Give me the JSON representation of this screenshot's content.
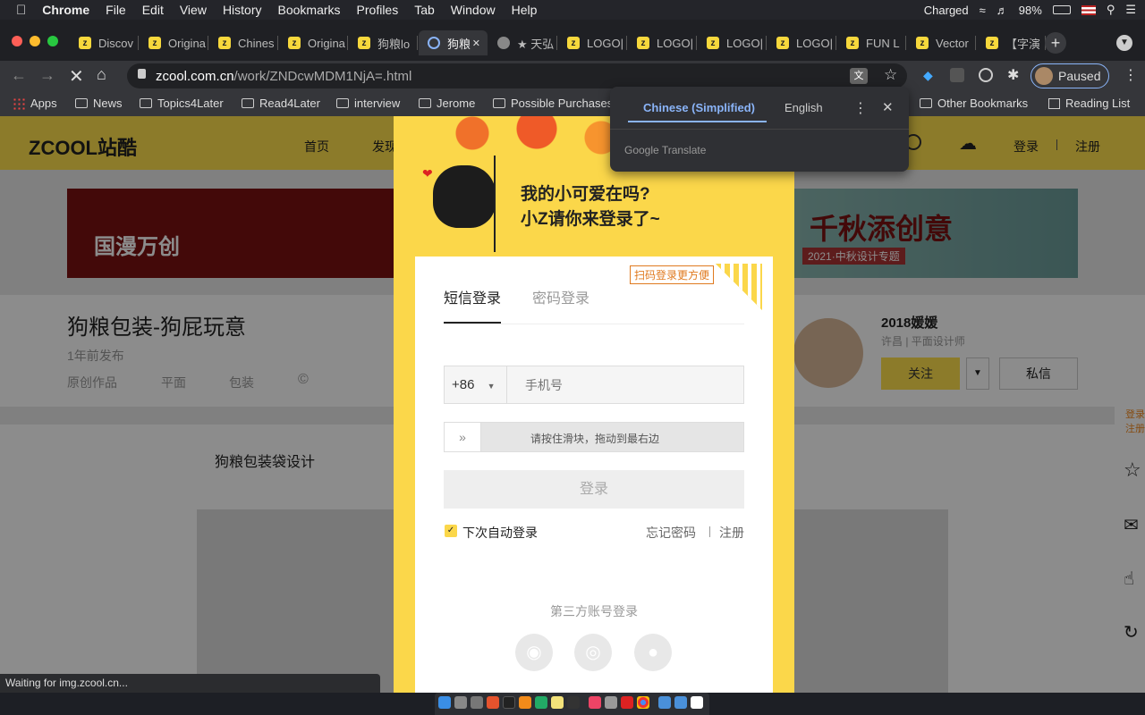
{
  "menubar": {
    "app": "Chrome",
    "items": [
      "File",
      "Edit",
      "View",
      "History",
      "Bookmarks",
      "Profiles",
      "Tab",
      "Window",
      "Help"
    ],
    "battery_status": "Charged",
    "battery_percent": "98%"
  },
  "tabs": [
    {
      "label": "Discov"
    },
    {
      "label": "Origina"
    },
    {
      "label": "Chines"
    },
    {
      "label": "Origina"
    },
    {
      "label": "狗粮lo"
    },
    {
      "label": "狗粮"
    },
    {
      "label": "★ 天弘"
    },
    {
      "label": "LOGO|"
    },
    {
      "label": "LOGO|"
    },
    {
      "label": "LOGO|"
    },
    {
      "label": "LOGO|"
    },
    {
      "label": "FUN L"
    },
    {
      "label": "Vector"
    },
    {
      "label": "【字演"
    }
  ],
  "address": {
    "host": "zcool.com.cn",
    "path": "/work/ZNDcwMDM1NjA=.html"
  },
  "profile": {
    "label": "Paused"
  },
  "bookmarks": {
    "apps": "Apps",
    "items": [
      "News",
      "Topics4Later",
      "Read4Later",
      "interview",
      "Jerome",
      "Possible Purchases"
    ],
    "other": "Other Bookmarks",
    "reading": "Reading List"
  },
  "translate": {
    "lang_source": "Chinese (Simplified)",
    "lang_target": "English",
    "provider": "Google Translate"
  },
  "site": {
    "logo": "ZCOOL站酷",
    "nav": [
      "首页",
      "发现"
    ],
    "login": "登录",
    "register": "注册",
    "banner_left": "国漫万创",
    "banner_right": "千秋添创意",
    "banner_sub": "2021·中秋设计专题",
    "work_title": "狗粮包装-狗屁玩意",
    "published": "1年前发布",
    "tags": [
      "原创作品",
      "平面",
      "包装"
    ],
    "section_title": "狗粮包装袋设计",
    "author": "2018媛媛",
    "author_meta": "许昌 | 平面设计师",
    "follow": "关注",
    "message": "私信",
    "side_login": "登录",
    "side_register": "注册"
  },
  "modal": {
    "greeting1": "我的小可爱在吗?",
    "greeting2": "小Z请你来登录了~",
    "qr_hint": "扫码登录更方便",
    "tab_sms": "短信登录",
    "tab_password": "密码登录",
    "country_code": "+86",
    "phone_placeholder": "手机号",
    "slider_text": "请按住滑块，拖动到最右边",
    "login_button": "登录",
    "remember": "下次自动登录",
    "forgot": "忘记密码",
    "register": "注册",
    "third_party": "第三方账号登录"
  },
  "status": {
    "text": "Waiting for img.zcool.cn..."
  }
}
